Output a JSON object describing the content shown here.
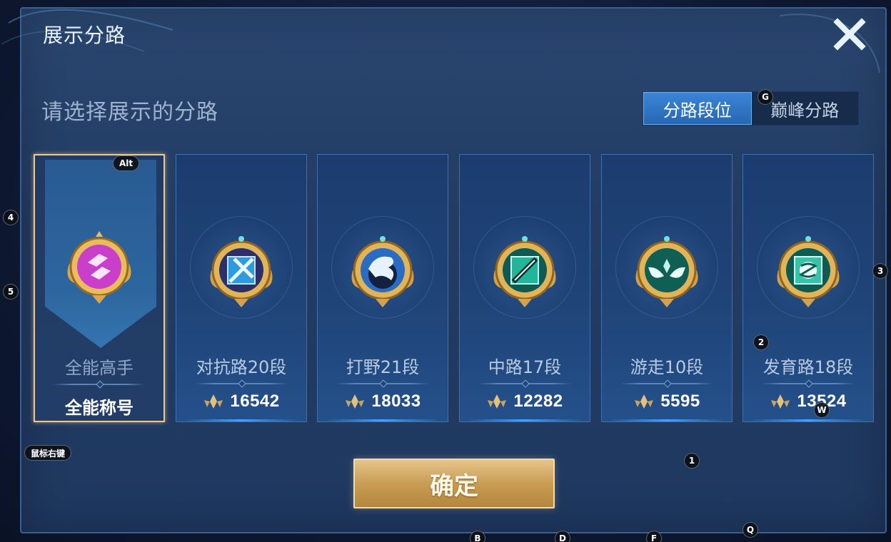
{
  "dialog": {
    "title": "展示分路",
    "subtitle": "请选择展示的分路",
    "close_icon": "close-x-icon"
  },
  "tabs": [
    {
      "label": "分路段位",
      "active": true
    },
    {
      "label": "巅峰分路",
      "active": false
    }
  ],
  "cards": [
    {
      "name": "全能高手",
      "subname": "全能称号",
      "selected": true,
      "emblem_color": "#c93fc9",
      "emblem": "all-round-icon"
    },
    {
      "name": "对抗路20段",
      "points": "16542",
      "emblem_color": "#2e9be0",
      "emblem": "clash-lane-icon"
    },
    {
      "name": "打野21段",
      "points": "18033",
      "emblem_color": "#2a6cc4",
      "emblem": "jungle-dragon-icon"
    },
    {
      "name": "中路17段",
      "points": "12282",
      "emblem_color": "#21b59a",
      "emblem": "mid-lane-icon"
    },
    {
      "name": "游走10段",
      "points": "5595",
      "emblem_color": "#1fa58a",
      "emblem": "roam-wings-icon"
    },
    {
      "name": "发育路18段",
      "points": "13524",
      "emblem_color": "#35c4a8",
      "emblem": "farm-lane-icon"
    }
  ],
  "confirm_label": "确定",
  "key_hints": {
    "alt": "Alt",
    "g": "G",
    "num4": "4",
    "num5": "5",
    "num3": "3",
    "num2": "2",
    "w": "W",
    "num1": "1",
    "right_click": "鼠标右键",
    "q": "Q",
    "b": "B",
    "d": "D",
    "f": "F"
  },
  "colors": {
    "accent_gold": "#f0c88a",
    "tab_active": "#2f78c8",
    "panel": "#233e66"
  }
}
